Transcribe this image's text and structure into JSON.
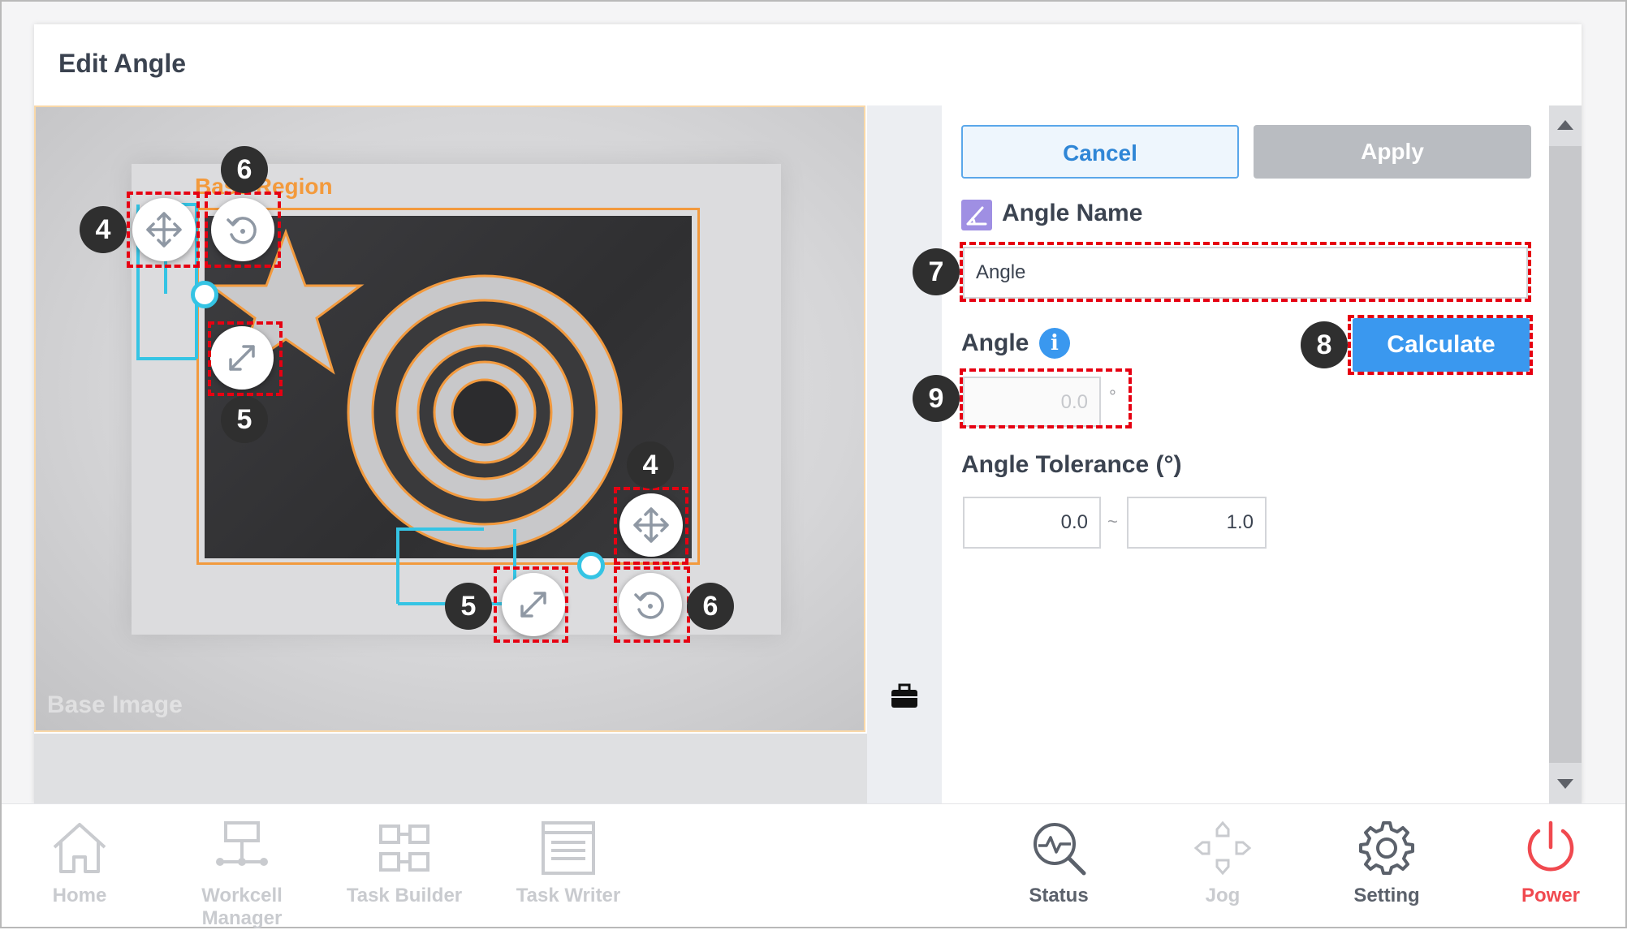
{
  "dialog": {
    "title": "Edit Angle"
  },
  "canvas": {
    "region_label": "Base Region",
    "image_label": "Base Image"
  },
  "panel": {
    "cancel_label": "Cancel",
    "apply_label": "Apply",
    "angle_name_label": "Angle Name",
    "angle_name_value": "Angle",
    "angle_label": "Angle",
    "angle_value": "0.0",
    "angle_unit": "°",
    "calculate_label": "Calculate",
    "tolerance_label": "Angle Tolerance (°)",
    "tolerance_min": "0.0",
    "tolerance_separator": "~",
    "tolerance_max": "1.0"
  },
  "callouts": {
    "move_a": "4",
    "move_b": "4",
    "resize_a": "5",
    "resize_b": "5",
    "rotate_a": "6",
    "rotate_b": "6",
    "name_field": "7",
    "calculate": "8",
    "angle_field": "9"
  },
  "nav": {
    "home": "Home",
    "workcell_manager": "Workcell Manager",
    "task_builder": "Task Builder",
    "task_writer": "Task Writer",
    "status": "Status",
    "jog": "Jog",
    "setting": "Setting",
    "power": "Power"
  },
  "colors": {
    "accent": "#3a98ef",
    "callout": "#e60012",
    "region": "#f29a3e",
    "handle_line": "#35c4e4",
    "power": "#f0494f"
  },
  "icons": {
    "move": "move-icon",
    "resize": "resize-icon",
    "rotate": "rotate-icon",
    "info": "info-icon",
    "toolbox": "toolbox-icon",
    "angle": "angle-icon"
  }
}
